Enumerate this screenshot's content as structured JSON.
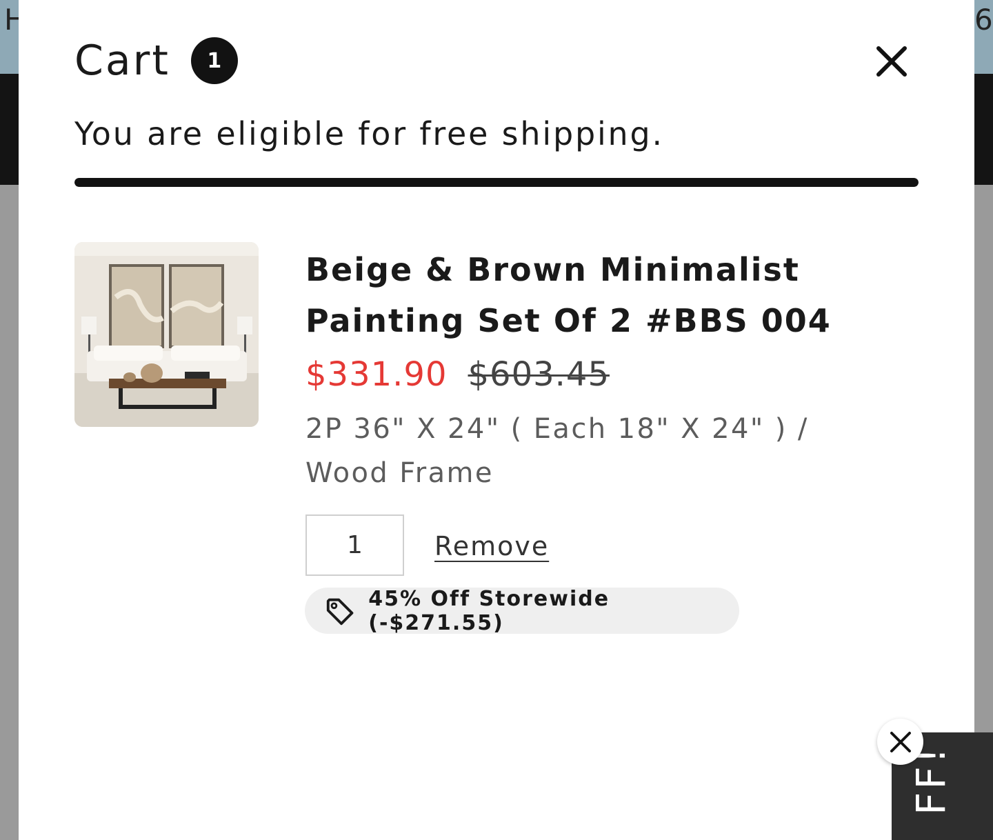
{
  "background": {
    "left_edge_text": "H",
    "right_edge_text": "6"
  },
  "cart": {
    "title": "Cart",
    "count": "1",
    "close_icon": "close-icon",
    "shipping_message": "You are eligible for free shipping.",
    "shipping_progress": 1.0,
    "items": [
      {
        "title": "Beige & Brown Minimalist Painting Set Of 2 #BBS 004",
        "sale_price": "$331.90",
        "compare_price": "$603.45",
        "variant": "2P 36\" X 24\" ( Each 18\" X 24\" ) / Wood Frame",
        "quantity": "1",
        "remove_label": "Remove",
        "discount": "45% Off Storewide (-$271.55)",
        "discount_icon": "tag-icon"
      }
    ]
  },
  "promo_tab": {
    "text": "FF!",
    "close_icon": "close-icon"
  },
  "colors": {
    "accent_sale": "#e53935",
    "dark": "#121212",
    "topbar": "#8ea9b6"
  }
}
